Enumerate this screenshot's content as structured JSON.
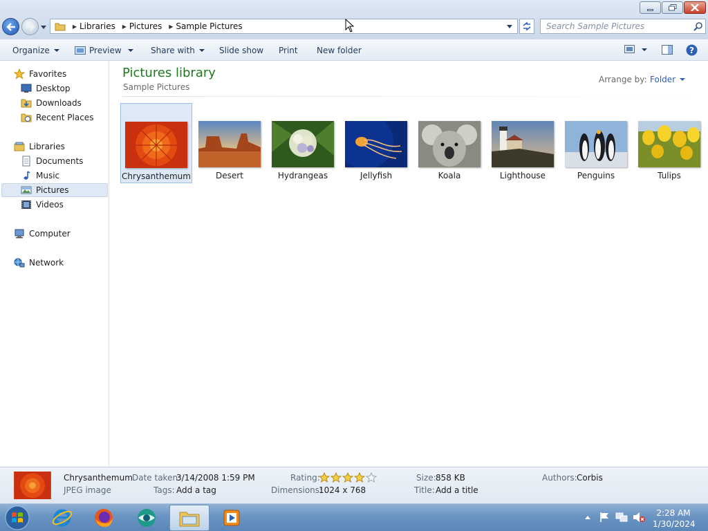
{
  "window": {
    "controls": {
      "minimize": "minimize",
      "maximize": "restore",
      "close": "close"
    }
  },
  "addressbar": {
    "crumbs": [
      "Libraries",
      "Pictures",
      "Sample Pictures"
    ]
  },
  "search": {
    "placeholder": "Search Sample Pictures"
  },
  "toolbar": {
    "organize": "Organize",
    "preview": "Preview",
    "share_with": "Share with",
    "slide_show": "Slide show",
    "print": "Print",
    "new_folder": "New folder"
  },
  "navpane": {
    "favorites": "Favorites",
    "desktop": "Desktop",
    "downloads": "Downloads",
    "recent_places": "Recent Places",
    "libraries": "Libraries",
    "documents": "Documents",
    "music": "Music",
    "pictures": "Pictures",
    "videos": "Videos",
    "computer": "Computer",
    "network": "Network"
  },
  "content": {
    "title": "Pictures library",
    "subtitle": "Sample Pictures",
    "arrange_label": "Arrange by:",
    "arrange_value": "Folder",
    "items": [
      "Chrysanthemum",
      "Desert",
      "Hydrangeas",
      "Jellyfish",
      "Koala",
      "Lighthouse",
      "Penguins",
      "Tulips"
    ],
    "selected": "Chrysanthemum"
  },
  "details": {
    "name": "Chrysanthemum",
    "type": "JPEG image",
    "date_taken_label": "Date taken:",
    "date_taken": "3/14/2008 1:59 PM",
    "tags_label": "Tags:",
    "tags": "Add a tag",
    "rating_label": "Rating:",
    "rating_stars": 4,
    "rating_max": 5,
    "dimensions_label": "Dimensions:",
    "dimensions": "1024 x 768",
    "size_label": "Size:",
    "size": "858 KB",
    "title_label": "Title:",
    "title": "Add a title",
    "authors_label": "Authors:",
    "authors": "Corbis"
  },
  "taskbar": {
    "time": "2:28 AM",
    "date": "1/30/2024"
  },
  "colors": {
    "library_title": "#1e7a1e",
    "link_blue": "#2a62b8",
    "selection": "#dde9f7"
  }
}
